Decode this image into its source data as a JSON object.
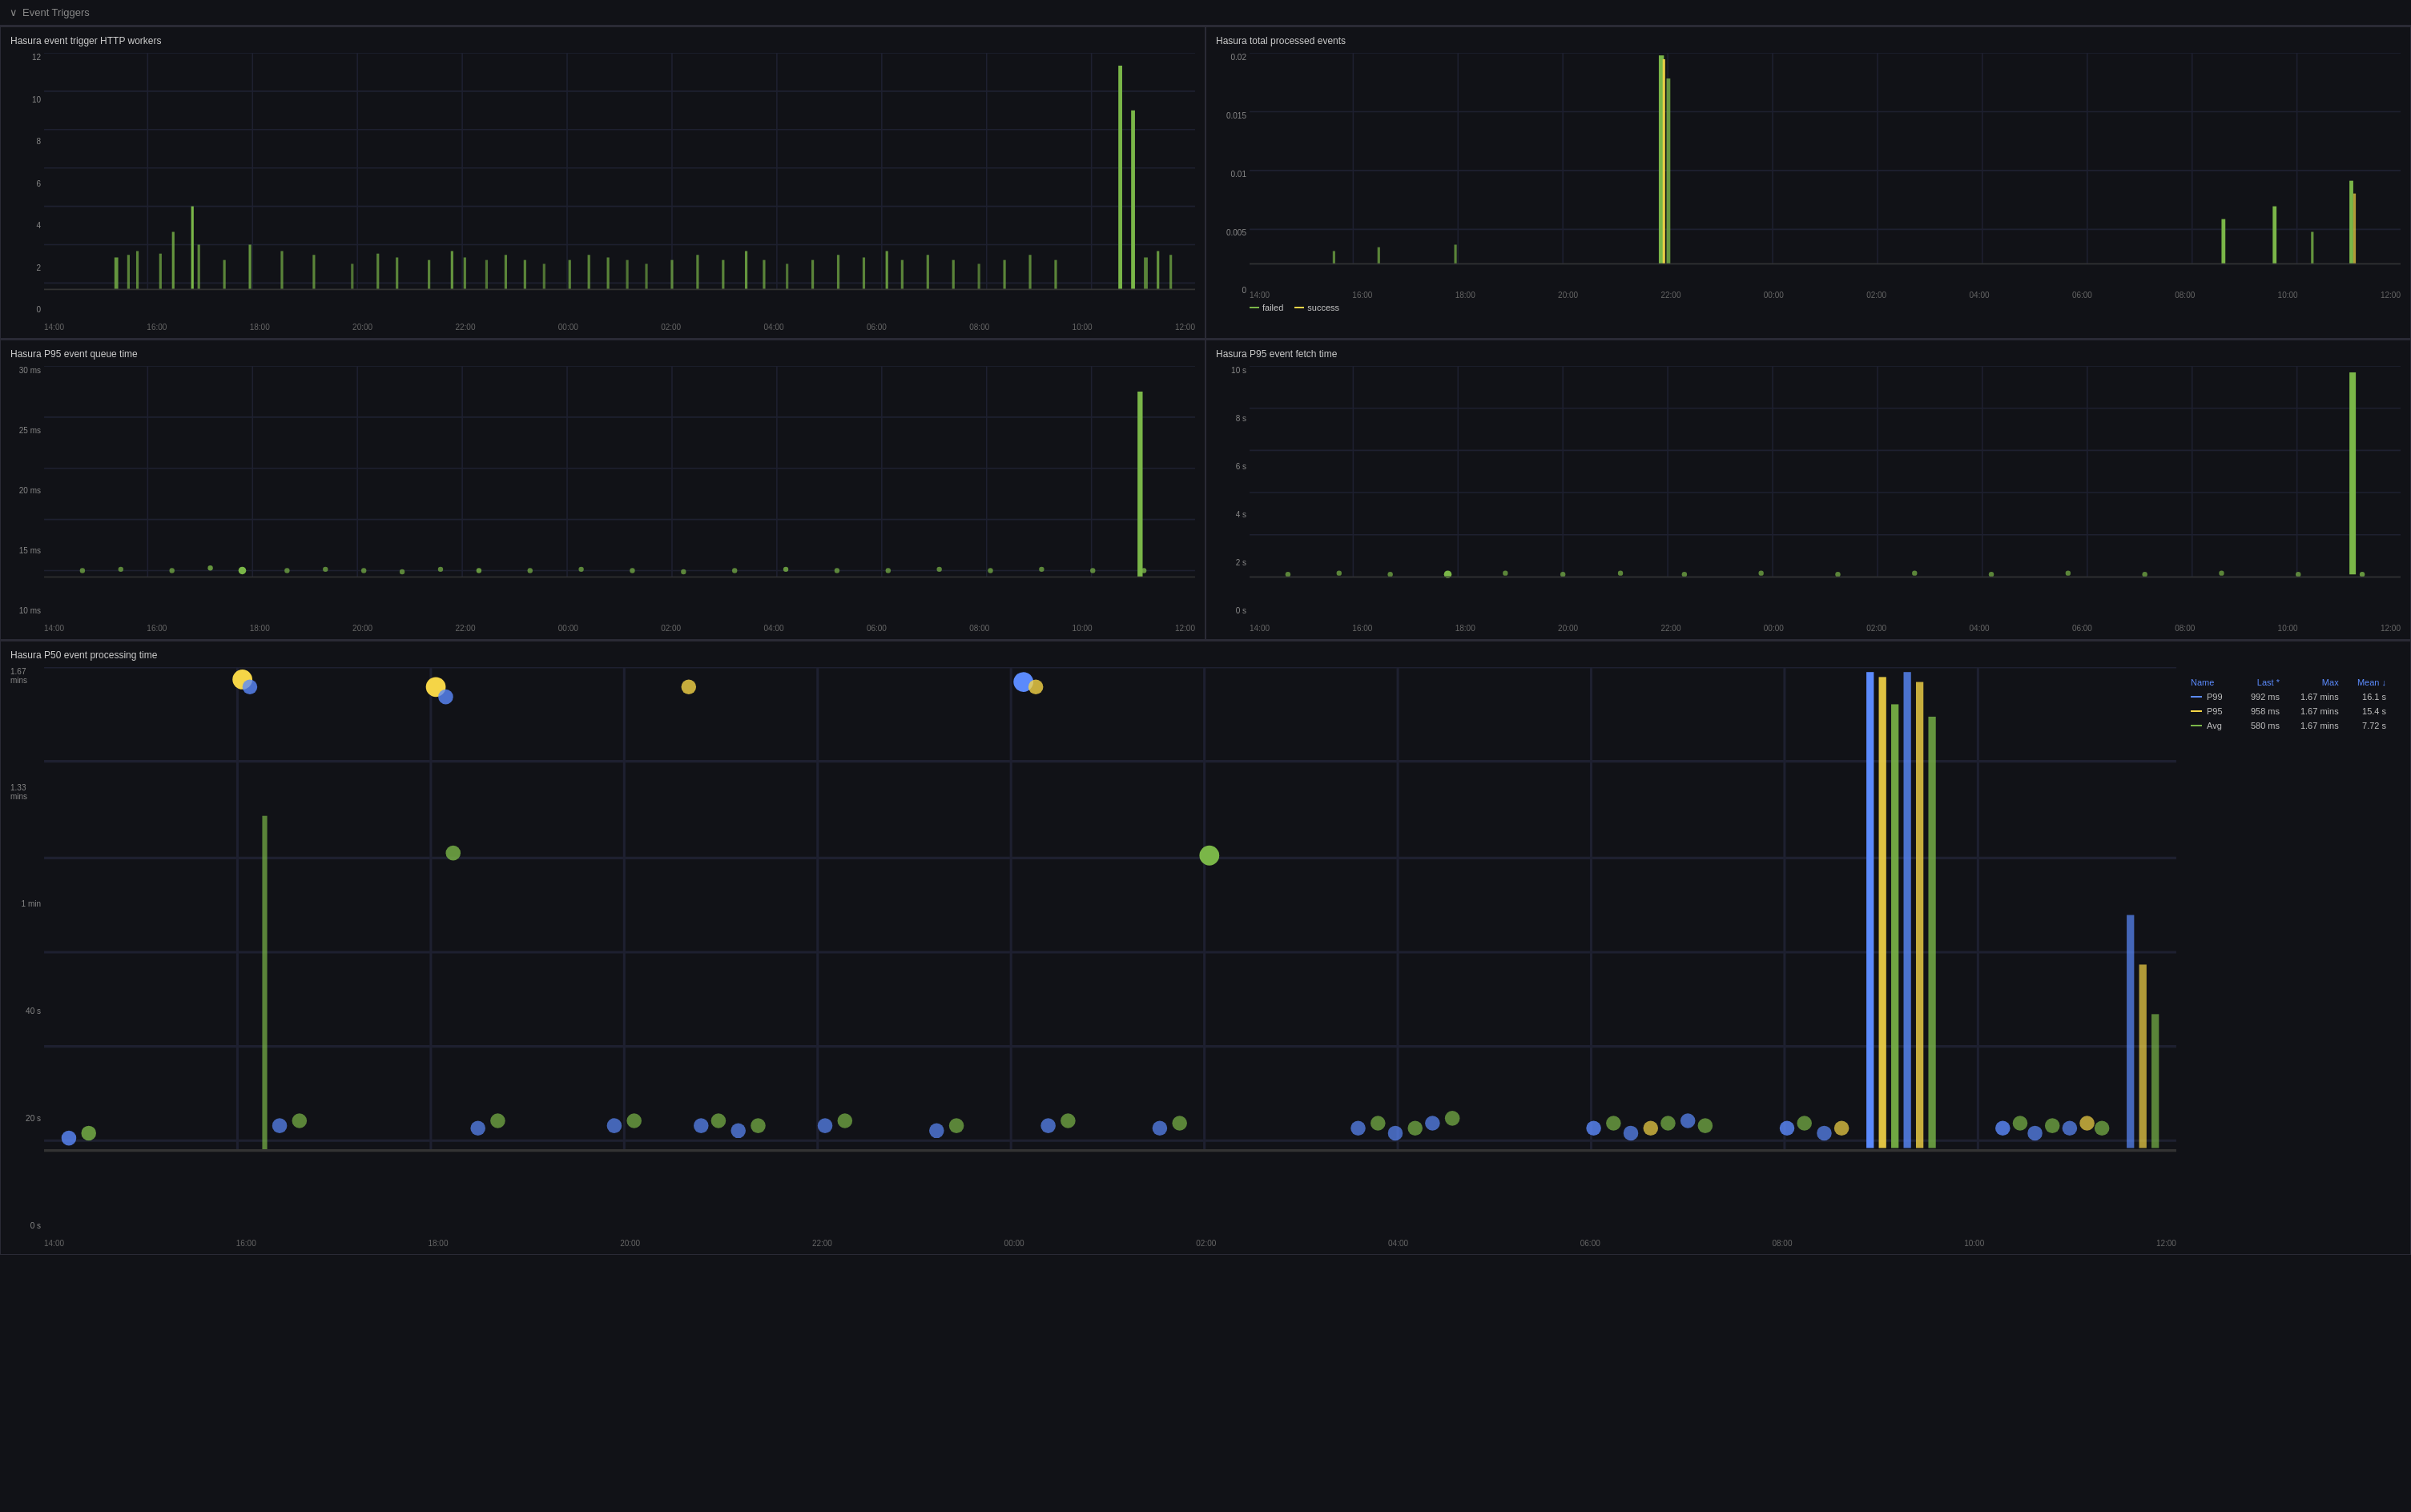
{
  "section": {
    "title": "Event Triggers",
    "chevron": "›"
  },
  "charts": {
    "http_workers": {
      "title": "Hasura event trigger HTTP workers",
      "y_labels": [
        "12",
        "10",
        "8",
        "6",
        "4",
        "2",
        "0"
      ],
      "x_labels": [
        "14:00",
        "16:00",
        "18:00",
        "20:00",
        "22:00",
        "00:00",
        "02:00",
        "04:00",
        "06:00",
        "08:00",
        "10:00",
        "12:00"
      ]
    },
    "total_processed": {
      "title": "Hasura total processed events",
      "y_labels": [
        "0.02",
        "0.015",
        "0.01",
        "0.005",
        "0"
      ],
      "x_labels": [
        "14:00",
        "16:00",
        "18:00",
        "20:00",
        "22:00",
        "00:00",
        "02:00",
        "04:00",
        "06:00",
        "08:00",
        "10:00",
        "12:00"
      ],
      "legend": [
        {
          "label": "failed",
          "color": "#7ab648"
        },
        {
          "label": "success",
          "color": "#f5d547"
        }
      ]
    },
    "p95_queue": {
      "title": "Hasura P95 event queue time",
      "y_labels": [
        "30 ms",
        "25 ms",
        "20 ms",
        "15 ms",
        "10 ms"
      ],
      "x_labels": [
        "14:00",
        "16:00",
        "18:00",
        "20:00",
        "22:00",
        "00:00",
        "02:00",
        "04:00",
        "06:00",
        "08:00",
        "10:00",
        "12:00"
      ]
    },
    "p95_fetch": {
      "title": "Hasura P95 event fetch time",
      "y_labels": [
        "10 s",
        "8 s",
        "6 s",
        "4 s",
        "2 s",
        "0 s"
      ],
      "x_labels": [
        "14:00",
        "16:00",
        "18:00",
        "20:00",
        "22:00",
        "00:00",
        "02:00",
        "04:00",
        "06:00",
        "08:00",
        "10:00",
        "12:00"
      ]
    },
    "p50_processing": {
      "title": "Hasura P50 event processing time",
      "y_labels": [
        "1.67 mins",
        "1.33 mins",
        "1 min",
        "40 s",
        "20 s",
        "0 s"
      ],
      "x_labels": [
        "14:00",
        "16:00",
        "18:00",
        "20:00",
        "22:00",
        "00:00",
        "02:00",
        "04:00",
        "06:00",
        "08:00",
        "10:00",
        "12:00"
      ],
      "series": [
        {
          "name": "P99",
          "color": "#5b8afc",
          "last": "992 ms",
          "max": "1.67 mins",
          "mean": "16.1 s"
        },
        {
          "name": "P95",
          "color": "#f5d547",
          "last": "958 ms",
          "max": "1.67 mins",
          "mean": "15.4 s"
        },
        {
          "name": "Avg",
          "color": "#7ab648",
          "last": "580 ms",
          "max": "1.67 mins",
          "mean": "7.72 s"
        }
      ],
      "table_headers": {
        "name": "Name",
        "last": "Last *",
        "max": "Max",
        "mean": "Mean ↓"
      }
    }
  },
  "colors": {
    "green": "#7ab648",
    "yellow": "#f5d547",
    "blue": "#5b8afc",
    "grid": "#1e2030",
    "border": "#2a2a35",
    "bg": "#111217",
    "text_primary": "#cccccc",
    "text_secondary": "#888888"
  }
}
